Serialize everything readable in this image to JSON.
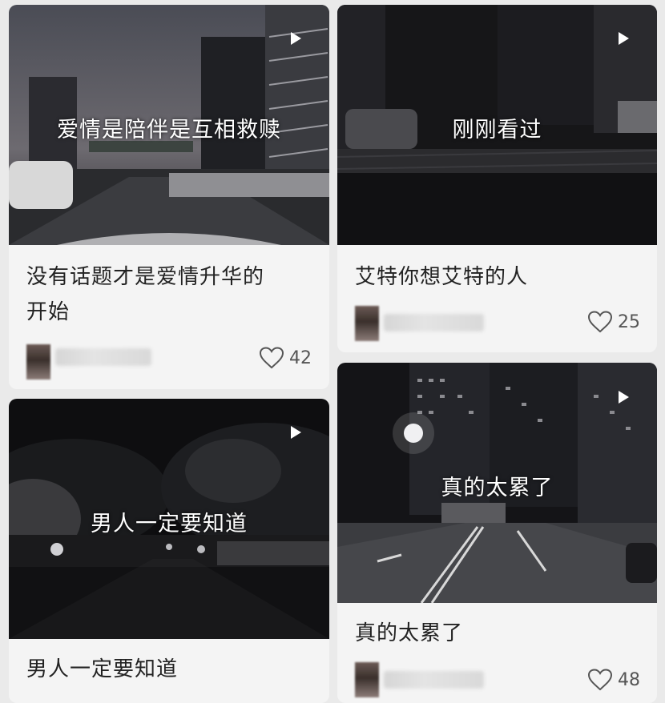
{
  "feed": {
    "cards": [
      {
        "overlay": "爱情是陪伴是互相救赎",
        "title_line1": "没有话题才是爱情升华的",
        "title_line2": "开始",
        "likes": "42",
        "icon": "heart-icon"
      },
      {
        "overlay": "刚刚看过",
        "title_line1": "艾特你想艾特的人",
        "likes": "25",
        "icon": "heart-icon"
      },
      {
        "overlay": "男人一定要知道",
        "title_line1": "男人一定要知道"
      },
      {
        "overlay": "真的太累了",
        "title_line1": "真的太累了",
        "likes": "48",
        "icon": "heart-icon"
      }
    ]
  },
  "colors": {
    "background": "#eaeaea",
    "card": "#f4f4f4",
    "text": "#222222",
    "icon": "#555555"
  }
}
